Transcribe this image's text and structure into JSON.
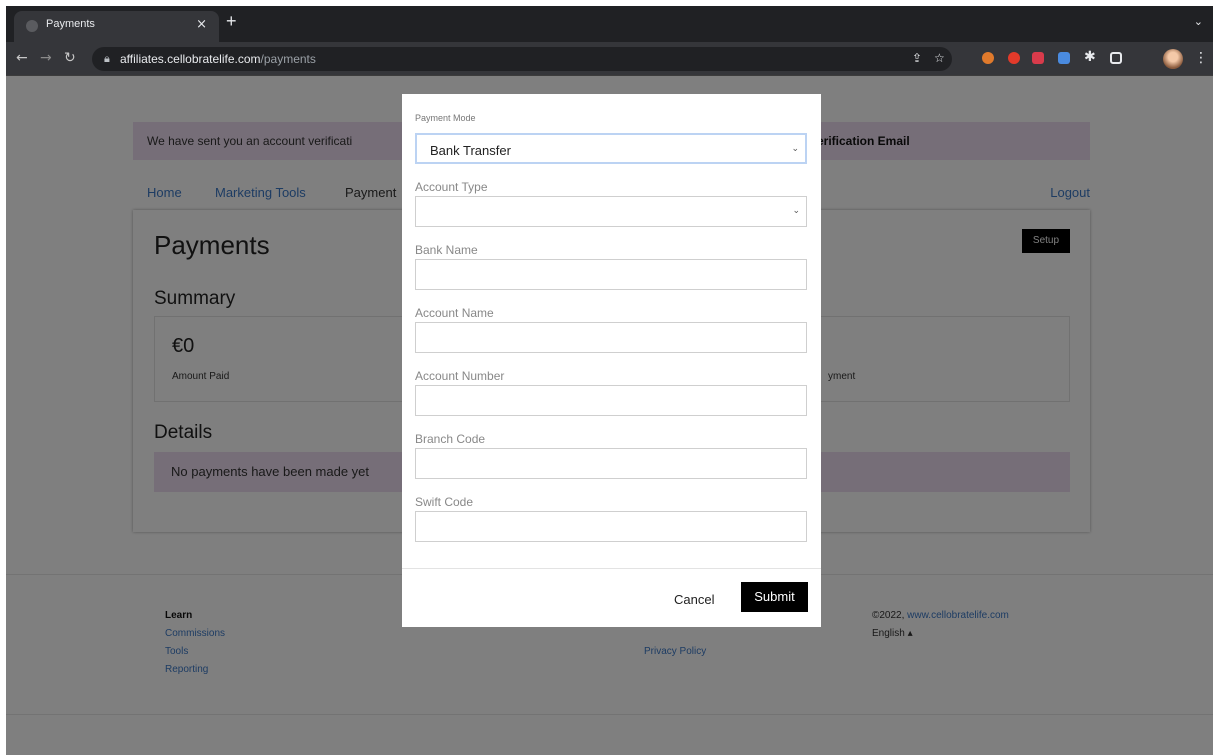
{
  "browser": {
    "tab_title": "Payments",
    "url_host": "affiliates.cellobratelife.com",
    "url_path": "/payments"
  },
  "banner": {
    "text_left": "We have sent you an account verificati",
    "text_right": "erification Email"
  },
  "nav": {
    "home": "Home",
    "marketing": "Marketing Tools",
    "payments": "Payment",
    "logout": "Logout"
  },
  "card": {
    "title": "Payments",
    "setup_label": "Setup",
    "summary_title": "Summary",
    "amount": "€0",
    "amount_label": "Amount Paid",
    "payment_label_partial": "yment",
    "details_title": "Details",
    "no_payments": "No payments have been made yet"
  },
  "footer": {
    "learn": "Learn",
    "commissions": "Commissions",
    "tools": "Tools",
    "reporting": "Reporting",
    "privacy": "Privacy Policy",
    "copyright_prefix": "©2022, ",
    "copyright_link": "www.cellobratelife.com",
    "language": "English ▴"
  },
  "modal": {
    "payment_mode_label": "Payment Mode",
    "payment_mode_value": "Bank Transfer",
    "account_type_label": "Account Type",
    "account_type_value": "",
    "bank_name_label": "Bank Name",
    "account_name_label": "Account Name",
    "account_number_label": "Account Number",
    "branch_code_label": "Branch Code",
    "swift_code_label": "Swift Code",
    "cancel_label": "Cancel",
    "submit_label": "Submit"
  }
}
